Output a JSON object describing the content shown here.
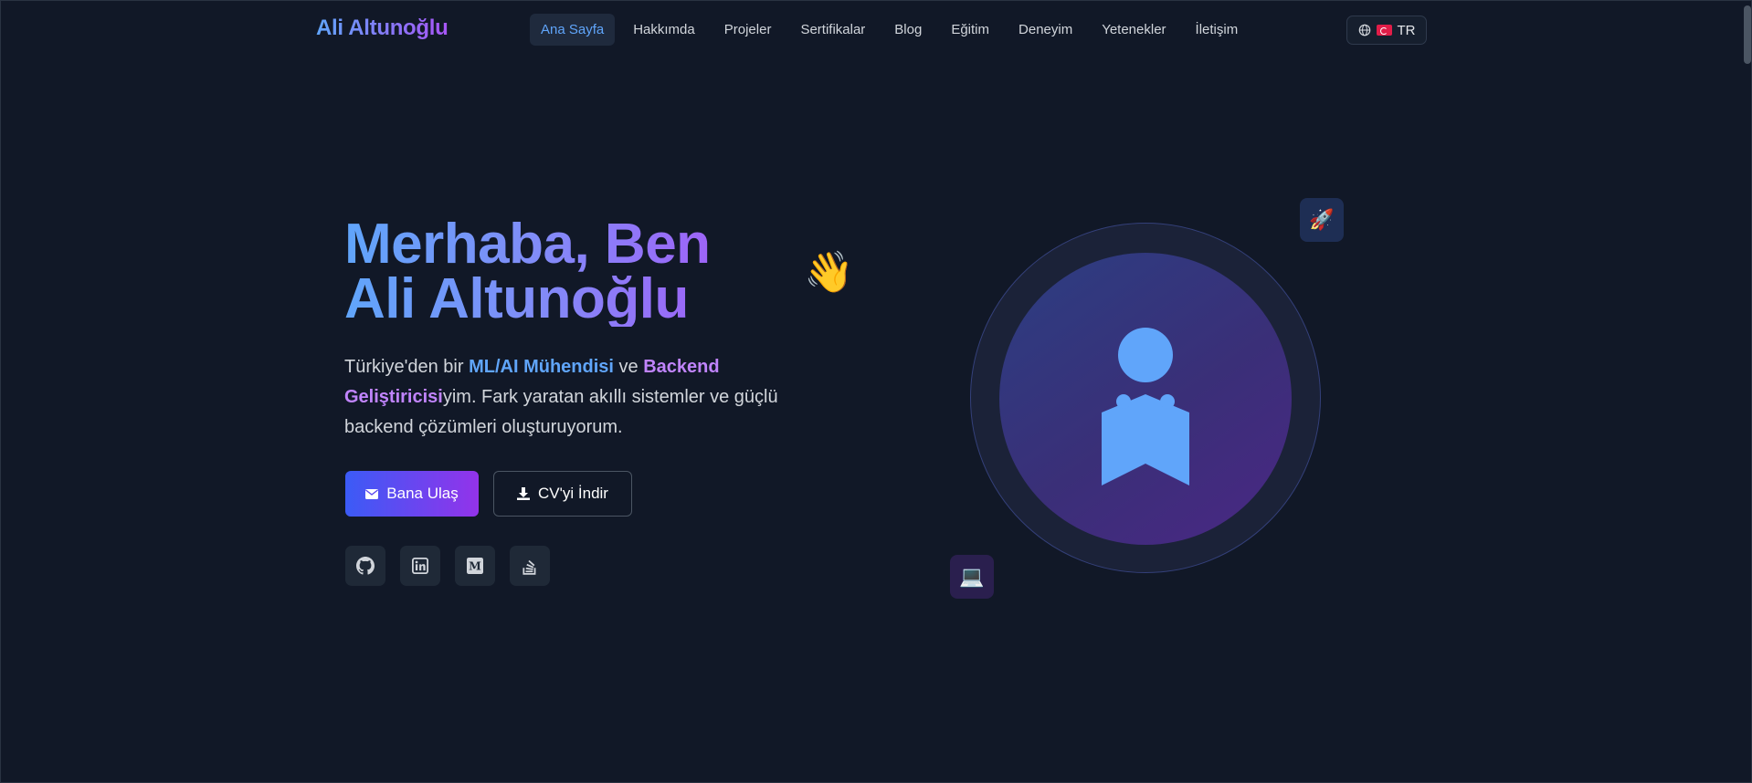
{
  "header": {
    "brand": "Ali Altunoğlu",
    "nav": [
      {
        "label": "Ana Sayfa",
        "active": true
      },
      {
        "label": "Hakkımda"
      },
      {
        "label": "Projeler"
      },
      {
        "label": "Sertifikalar"
      },
      {
        "label": "Blog"
      },
      {
        "label": "Eğitim"
      },
      {
        "label": "Deneyim"
      },
      {
        "label": "Yetenekler"
      },
      {
        "label": "İletişim"
      }
    ],
    "language": {
      "icon": "globe-icon",
      "flag": "turkey-flag-icon",
      "label": "TR"
    }
  },
  "hero": {
    "title_line1": "Merhaba, Ben",
    "title_line2": "Ali Altunoğlu",
    "wave_emoji": "👋",
    "desc_prefix": "Türkiye'den bir ",
    "desc_role1": "ML/AI Mühendisi",
    "desc_mid": " ve ",
    "desc_role2": "Backend Geliştiricisi",
    "desc_suffix": "yim. Fark yaratan akıllı sistemler ve güçlü backend çözümleri oluşturuyorum.",
    "primary_button": {
      "label": "Bana Ulaş",
      "icon": "envelope-icon"
    },
    "secondary_button": {
      "label": "CV'yi İndir",
      "icon": "download-icon"
    },
    "socials": [
      {
        "icon": "github-icon"
      },
      {
        "icon": "linkedin-icon"
      },
      {
        "icon": "medium-icon"
      },
      {
        "icon": "stackoverflow-icon"
      }
    ]
  },
  "avatar": {
    "badge_top": "🚀",
    "badge_bottom": "💻"
  },
  "colors": {
    "background": "#111827",
    "accent_blue": "#60a5fa",
    "accent_purple": "#a855f7"
  }
}
